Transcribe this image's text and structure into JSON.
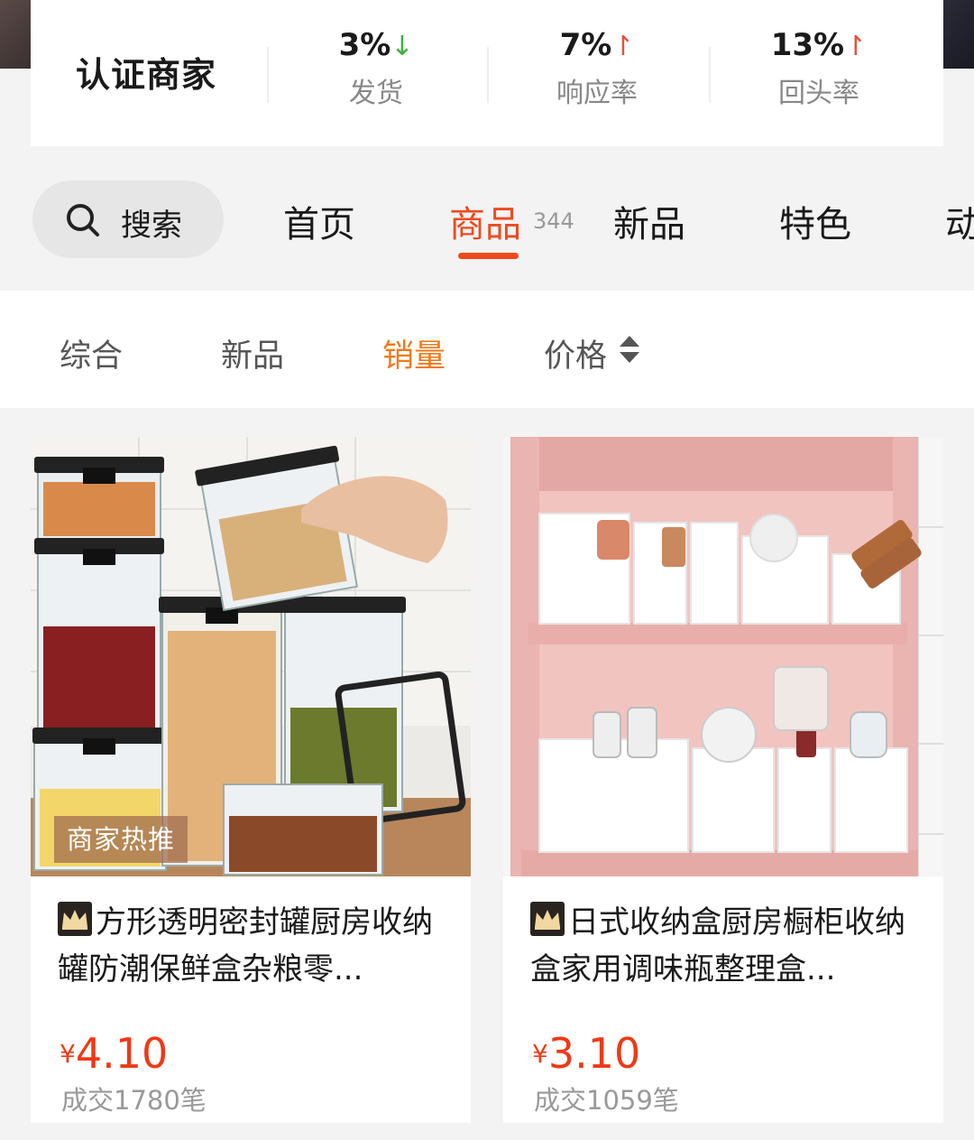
{
  "shop_stats": {
    "certified_label": "认证商家",
    "items": [
      {
        "value": "3%",
        "trend": "down",
        "label": "发货"
      },
      {
        "value": "7%",
        "trend": "up",
        "label": "响应率"
      },
      {
        "value": "13%",
        "trend": "up",
        "label": "回头率"
      }
    ]
  },
  "tabs": {
    "search_label": "搜索",
    "items": [
      {
        "label": "首页"
      },
      {
        "label": "商品",
        "count": "344",
        "active": true
      },
      {
        "label": "新品"
      },
      {
        "label": "特色"
      },
      {
        "label": "动"
      }
    ]
  },
  "sort": {
    "items": [
      "综合",
      "新品",
      "销量",
      "价格"
    ],
    "active": "销量"
  },
  "products": [
    {
      "badge": "商家热推",
      "title": "方形透明密封罐厨房收纳罐防潮保鲜盒杂粮零...",
      "currency": "¥",
      "price": "4.10",
      "sales": "成交1780笔"
    },
    {
      "title": "日式收纳盒厨房橱柜收纳盒家用调味瓶整理盒...",
      "currency": "¥",
      "price": "3.10",
      "sales": "成交1059笔"
    }
  ],
  "colors": {
    "accent": "#ee4a1e",
    "sort_active": "#f07a1a",
    "trend_down": "#3fae3f",
    "trend_up": "#e8503a"
  }
}
